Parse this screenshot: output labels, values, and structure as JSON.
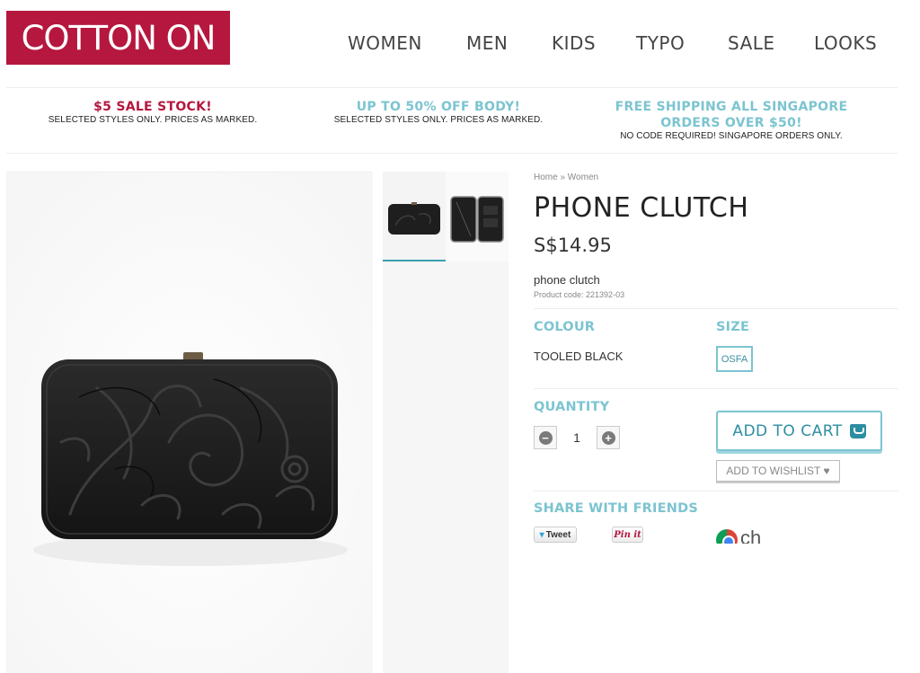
{
  "header": {
    "logo_text": "COTTON ON",
    "nav": [
      "WOMEN",
      "MEN",
      "KIDS",
      "TYPO",
      "SALE",
      "LOOKS"
    ]
  },
  "promos": [
    {
      "headline": "$5 SALE STOCK!",
      "sub": "SELECTED STYLES ONLY. PRICES AS MARKED.",
      "color": "#b5173f"
    },
    {
      "headline": "UP TO 50% OFF BODY!",
      "sub": "SELECTED STYLES ONLY. PRICES AS MARKED.",
      "color": "#7cc4d1"
    },
    {
      "headline": "FREE SHIPPING ALL SINGAPORE ORDERS OVER $50!",
      "sub": "NO CODE REQUIRED! SINGAPORE ORDERS ONLY.",
      "color": "#7cc4d1"
    }
  ],
  "product": {
    "breadcrumb": "Home » Women",
    "title": "PHONE CLUTCH",
    "price": "S$14.95",
    "description": "phone clutch",
    "code": "Product code: 221392-03",
    "colour_label": "COLOUR",
    "colour_value": "TOOLED BLACK",
    "size_label": "SIZE",
    "size_value": "OSFA",
    "quantity_label": "QUANTITY",
    "quantity_value": "1",
    "add_to_cart": "ADD TO CART",
    "add_to_wishlist": "ADD TO WISHLIST ♥",
    "share_label": "SHARE WITH FRIENDS",
    "tweet": "Tweet",
    "pinit": "Pin it",
    "chrome_text": "ch"
  },
  "colors": {
    "brand": "#b5173f",
    "accent": "#7cc4d1",
    "accent_dark": "#2d8ea1"
  }
}
